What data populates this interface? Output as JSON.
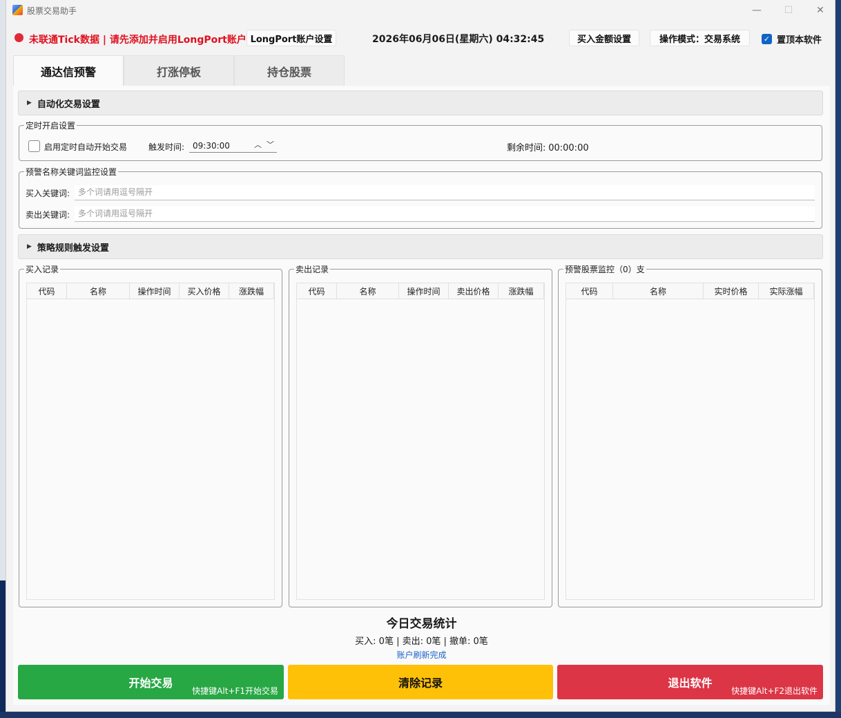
{
  "window": {
    "title": "股票交易助手"
  },
  "topbar": {
    "warning": "未联通Tick数据 | 请先添加并启用LongPort账户",
    "longport_button": "LongPort账户设置",
    "datetime": "2026年06月06日(星期六) 04:32:45",
    "amount_button": "买入金额设置",
    "mode_button": "操作模式：交易系统",
    "pin_label": "置顶本软件",
    "pin_checked": true
  },
  "tabs": [
    {
      "label": "通达信预警",
      "active": true
    },
    {
      "label": "打涨停板",
      "active": false
    },
    {
      "label": "持仓股票",
      "active": false
    }
  ],
  "auto_section": {
    "label": "自动化交易设置"
  },
  "timer_group": {
    "title": "定时开启设置",
    "checkbox_label": "启用定时自动开始交易",
    "trigger_label": "触发时间:",
    "trigger_value": "09:30:00",
    "remaining_label": "剩余时间:",
    "remaining_value": "00:00:00"
  },
  "keyword_group": {
    "title": "预警名称关键词监控设置",
    "buy_label": "买入关键词:",
    "buy_placeholder": "多个词请用逗号隔开",
    "sell_label": "卖出关键词:",
    "sell_placeholder": "多个词请用逗号隔开"
  },
  "strategy_section": {
    "label": "策略规则触发设置"
  },
  "buy_records": {
    "title": "买入记录",
    "columns": [
      "代码",
      "名称",
      "操作时间",
      "买入价格",
      "涨跌幅"
    ]
  },
  "sell_records": {
    "title": "卖出记录",
    "columns": [
      "代码",
      "名称",
      "操作时间",
      "卖出价格",
      "涨跌幅"
    ]
  },
  "monitor": {
    "title": "预警股票监控（0）支",
    "columns": [
      "代码",
      "名称",
      "实时价格",
      "实际涨幅"
    ]
  },
  "stats": {
    "title": "今日交易统计",
    "line": "买入: 0笔 | 卖出: 0笔 | 撤单: 0笔",
    "status": "账户刷新完成"
  },
  "actions": {
    "start": "开始交易",
    "start_hint": "快捷键Alt+F1开始交易",
    "clear": "清除记录",
    "exit": "退出软件",
    "exit_hint": "快捷键Alt+F2退出软件"
  },
  "colors": {
    "start": "#28a745",
    "clear": "#ffc107",
    "exit": "#dc3545",
    "warning": "#e0101e"
  }
}
